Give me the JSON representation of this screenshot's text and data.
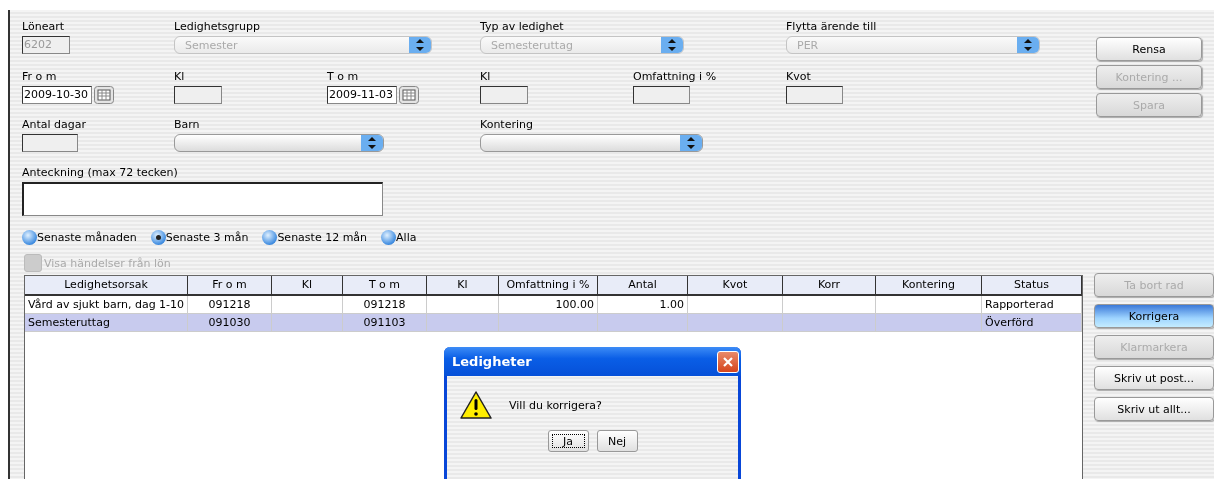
{
  "form_rows": [
    [
      {
        "kind": "text",
        "label": "Löneart",
        "value": "6202",
        "disabled": true
      },
      {
        "kind": "select",
        "label": "Ledighetsgrupp",
        "value": "Semester",
        "disabled": true
      },
      {
        "kind": "select",
        "label": "Typ av ledighet",
        "value": "Semesteruttag",
        "disabled": true
      },
      {
        "kind": "select",
        "label": "Flytta ärende till",
        "value": "PER",
        "disabled": true
      }
    ],
    [
      {
        "kind": "date",
        "label": "Fr o m",
        "value": "2009-10-30",
        "disabled": false
      },
      {
        "kind": "text",
        "label": "Kl",
        "disabled": true
      },
      {
        "kind": "date",
        "label": "T o m",
        "value": "2009-11-03",
        "disabled": false
      },
      {
        "kind": "text",
        "label": "Kl",
        "disabled": true
      },
      {
        "kind": "text",
        "label": "Omfattning i %",
        "disabled": true
      },
      {
        "kind": "text",
        "label": "Kvot",
        "disabled": true
      }
    ],
    [
      {
        "kind": "text",
        "label": "Antal dagar",
        "disabled": true
      },
      {
        "kind": "select",
        "label": "Barn",
        "disabled": false
      },
      {
        "kind": "select",
        "label": "Kontering",
        "disabled": false
      }
    ]
  ],
  "note": {
    "label": "Anteckning (max 72 tecken)"
  },
  "period": [
    {
      "label": "Senaste månaden",
      "selected": false
    },
    {
      "label": "Senaste 3 mån",
      "selected": true
    },
    {
      "label": "Senaste 12 mån",
      "selected": false
    },
    {
      "label": "Alla",
      "selected": false
    }
  ],
  "show_payroll": {
    "label": "Visa händelser från lön",
    "checked": false,
    "disabled": true
  },
  "top_buttons": [
    {
      "label": "Rensa",
      "disabled": false
    },
    {
      "label": "Kontering ...",
      "disabled": true
    },
    {
      "label": "Spara",
      "disabled": true
    }
  ],
  "table": {
    "columns": [
      {
        "label": "Ledighetsorsak",
        "kind": "text"
      },
      {
        "label": "Fr o m",
        "kind": "date"
      },
      {
        "label": "Kl",
        "kind": "date"
      },
      {
        "label": "T o m",
        "kind": "date"
      },
      {
        "label": "Kl",
        "kind": "date"
      },
      {
        "label": "Omfattning i %",
        "kind": "number"
      },
      {
        "label": "Antal",
        "kind": "number"
      },
      {
        "label": "Kvot",
        "kind": "number"
      },
      {
        "label": "Korr",
        "kind": "text"
      },
      {
        "label": "Kontering",
        "kind": "text"
      },
      {
        "label": "Status",
        "kind": "text"
      }
    ],
    "rows": [
      {
        "selected": false,
        "cells": [
          "Vård av sjukt barn, dag 1-10",
          "091218",
          "",
          "091218",
          "",
          "100.00",
          "1.00",
          "",
          "",
          "",
          "Rapporterad"
        ]
      },
      {
        "selected": true,
        "cells": [
          "Semesteruttag",
          "091030",
          "",
          "091103",
          "",
          "",
          "",
          "",
          "",
          "",
          "Överförd"
        ]
      }
    ]
  },
  "side_buttons": [
    {
      "label": "Ta bort rad",
      "disabled": true,
      "default": false
    },
    {
      "label": "Korrigera",
      "disabled": false,
      "default": true
    },
    {
      "label": "Klarmarkera",
      "disabled": true,
      "default": false
    },
    {
      "label": "Skriv ut post...",
      "disabled": false,
      "default": false
    },
    {
      "label": "Skriv ut allt...",
      "disabled": false,
      "default": false
    }
  ],
  "dialog": {
    "title": "Ledigheter",
    "message": "Vill du korrigera?",
    "buttons": [
      {
        "label": "Ja",
        "focused": true
      },
      {
        "label": "Nej",
        "focused": false
      }
    ]
  }
}
